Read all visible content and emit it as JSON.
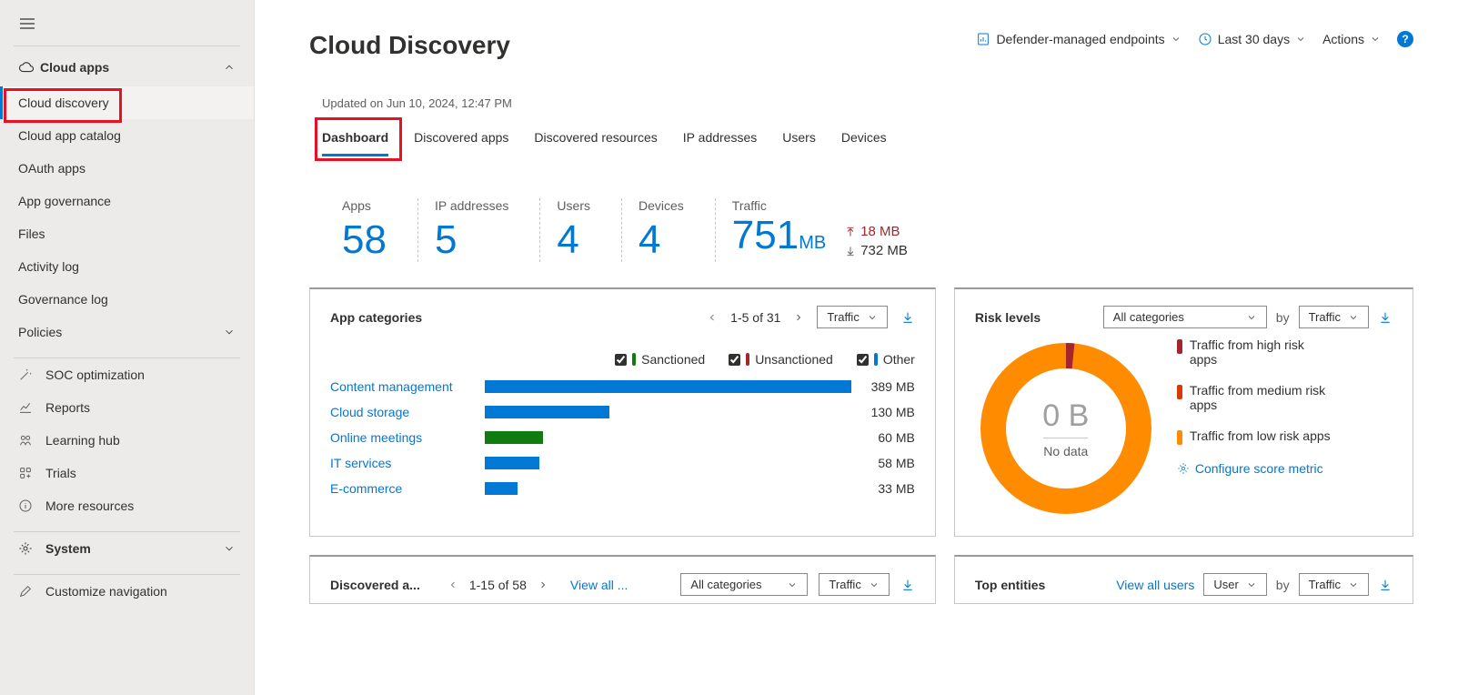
{
  "sidebar": {
    "section_label": "Cloud apps",
    "items": {
      "cloud_discovery": "Cloud discovery",
      "cloud_app_catalog": "Cloud app catalog",
      "oauth": "OAuth apps",
      "app_gov": "App governance",
      "files": "Files",
      "activity": "Activity log",
      "gov_log": "Governance log",
      "policies": "Policies",
      "soc": "SOC optimization",
      "reports": "Reports",
      "learning": "Learning hub",
      "trials": "Trials",
      "more": "More resources",
      "system": "System",
      "customize": "Customize navigation"
    }
  },
  "header": {
    "title": "Cloud Discovery",
    "source": "Defender-managed endpoints",
    "range": "Last 30 days",
    "actions": "Actions"
  },
  "updated": "Updated on Jun 10, 2024, 12:47 PM",
  "tabs": {
    "dashboard": "Dashboard",
    "discovered_apps": "Discovered apps",
    "discovered_res": "Discovered resources",
    "ip": "IP addresses",
    "users": "Users",
    "devices": "Devices"
  },
  "stats": {
    "apps_label": "Apps",
    "apps_value": "58",
    "ip_label": "IP addresses",
    "ip_value": "5",
    "users_label": "Users",
    "users_value": "4",
    "devices_label": "Devices",
    "devices_value": "4",
    "traffic_label": "Traffic",
    "traffic_value": "751",
    "traffic_unit": "MB",
    "traffic_up": "18 MB",
    "traffic_down": "732 MB"
  },
  "app_cat": {
    "title": "App categories",
    "pager": "1-5 of 31",
    "sort": "Traffic",
    "legend": {
      "sanctioned": "Sanctioned",
      "unsanctioned": "Unsanctioned",
      "other": "Other"
    }
  },
  "chart_data": {
    "type": "bar",
    "title": "App categories",
    "xlabel": "",
    "ylabel": "",
    "categories": [
      "Content management",
      "Cloud storage",
      "Online meetings",
      "IT services",
      "E-commerce"
    ],
    "values_label": [
      "389 MB",
      "130 MB",
      "60 MB",
      "58 MB",
      "33 MB"
    ],
    "values_pct": [
      100,
      34,
      16,
      15,
      9
    ],
    "colors": [
      "#0078d4",
      "#0078d4",
      "#107c10",
      "#0078d4",
      "#0078d4"
    ]
  },
  "risk": {
    "title": "Risk levels",
    "category": "All categories",
    "by": "by",
    "sort": "Traffic",
    "center_val": "0 B",
    "center_sub": "No data",
    "high": "Traffic from high risk apps",
    "med": "Traffic from medium risk apps",
    "low": "Traffic from low risk apps",
    "cfg": "Configure score metric"
  },
  "discovered_panel": {
    "title": "Discovered a...",
    "pager": "1-15 of 58",
    "view_all": "View all ...",
    "category": "All categories",
    "sort": "Traffic"
  },
  "top_entities": {
    "title": "Top entities",
    "view_all": "View all users",
    "user": "User",
    "by": "by",
    "sort": "Traffic"
  }
}
